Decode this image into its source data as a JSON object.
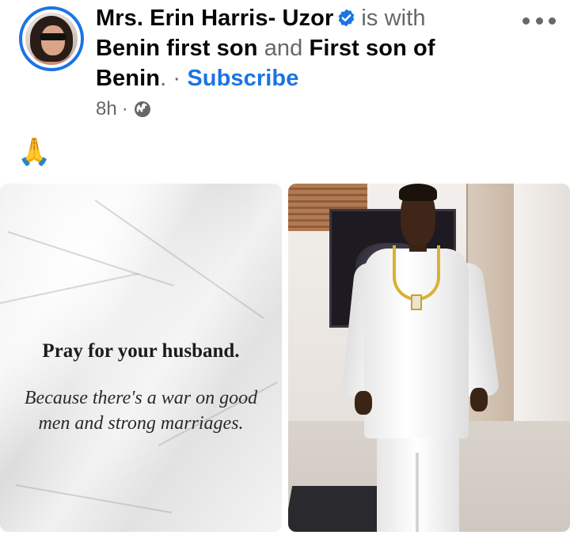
{
  "post": {
    "author": "Mrs. Erin Harris- Uzor",
    "with_text": "is with",
    "tagged_1": "Benin first son",
    "and_text": "and",
    "tagged_2_part1": "First son of",
    "tagged_2_part2": "Benin",
    "period": ".",
    "dot_sep": " · ",
    "subscribe_label": "Subscribe",
    "time": "8h",
    "meta_sep": "·",
    "body_emoji": "🙏"
  },
  "photos": {
    "left": {
      "title": "Pray for your husband.",
      "body": "Because there's a war on good men and strong marriages."
    }
  },
  "icons": {
    "verified": "verified-badge-icon",
    "privacy": "globe-icon",
    "more": "more-options-icon"
  },
  "colors": {
    "accent": "#1b74e4",
    "muted_text": "#65676b",
    "primary_text": "#050505"
  }
}
